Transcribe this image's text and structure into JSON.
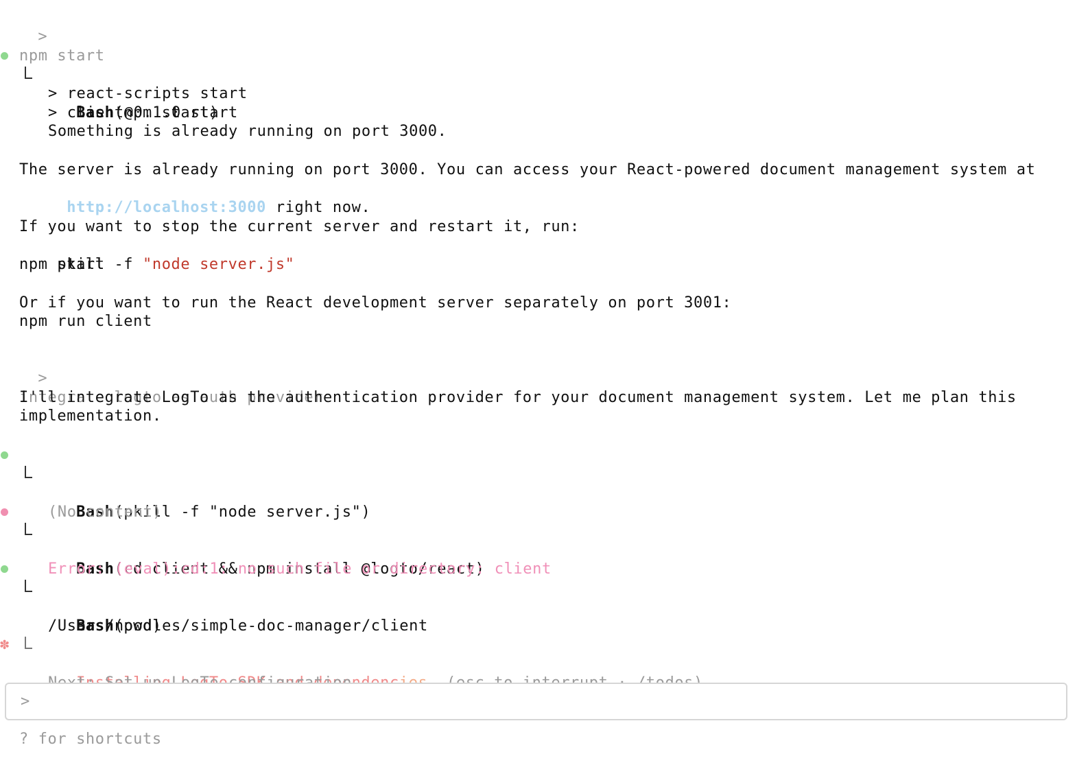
{
  "history": {
    "cmd1": "npm start",
    "bash1": {
      "tool": "Bash",
      "arg": "(npm start)",
      "out1": "> client@0.1.0 start",
      "out2": "> react-scripts start",
      "out3": "Something is already running on port 3000."
    },
    "msg1": {
      "line1": "The server is already running on port 3000. You can access your React-powered document management system at",
      "link": "http://localhost:3000",
      "after_link": " right now."
    },
    "msg2": {
      "line1": "If you want to stop the current server and restart it, run:",
      "cmd_prefix": "pkill -f ",
      "cmd_string": "\"node server.js\"",
      "line3": "npm start"
    },
    "msg3": {
      "line1": "Or if you want to run the React development server separately on port 3001:",
      "line2": "npm run client"
    },
    "cmd2": "integrate logto as auth provider",
    "msg4": {
      "line1": "I'll integrate LogTo as the authentication provider for your document management system. Let me plan this",
      "line2": "implementation."
    },
    "bash2": {
      "tool": "Bash",
      "arg": "(pkill -f \"node server.js\")",
      "out": "(No content)"
    },
    "bash3": {
      "tool": "Bash",
      "arg": "(cd client && npm install @logto/react)",
      "out": "Error: (eval):cd:1: no such file or directory: client"
    },
    "bash4": {
      "tool": "Bash",
      "arg": "(pwd)",
      "out": "/Users/noodles/simple-doc-manager/client"
    },
    "status": {
      "star": "✽",
      "text_a": "Installing LogTo SDK and dependenc",
      "text_b": "ies…",
      "hint": " (esc to interrupt · /todos)",
      "next": "Next: Set up LogTo configuration"
    }
  },
  "prompt": {
    "chevron": ">",
    "chevron_small": ">",
    "value": "",
    "placeholder": ""
  },
  "footer": {
    "shortcuts": "? for shortcuts"
  },
  "colors": {
    "success": "#8fd88f",
    "error": "#f08fb0",
    "link": "#a9d4f0",
    "string": "#c0392b",
    "accent": "#f08a8a"
  }
}
